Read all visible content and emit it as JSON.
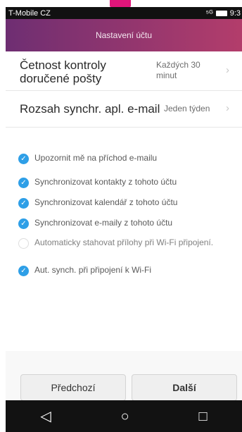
{
  "status_bar": {
    "carrier": "T-Mobile CZ",
    "signal": "⁵ᴳ",
    "time": "9:3"
  },
  "title_bar": {
    "title": "Nastavení účtu"
  },
  "settings": [
    {
      "label": "Četnost kontroly doručené pošty",
      "value": "Každých 30 minut"
    },
    {
      "label": "Rozsah synchr. apl. e-mail",
      "value": "Jeden týden"
    }
  ],
  "checkboxes": [
    {
      "label": "Upozornit mě na příchod e-mailu",
      "checked": true
    },
    {
      "label": "Synchronizovat kontakty z tohoto účtu",
      "checked": true
    },
    {
      "label": "Synchronizovat kalendář z tohoto účtu",
      "checked": true
    },
    {
      "label": "Synchronizovat e-maily z tohoto účtu",
      "checked": true
    },
    {
      "label": "Automaticky stahovat přílohy při Wi-Fi připojení.",
      "checked": false
    },
    {
      "label": "Aut. synch. při připojení k Wi-Fi",
      "checked": true
    }
  ],
  "buttons": {
    "previous": "Předchozí",
    "next": "Další"
  },
  "nav_icons": [
    "back-icon",
    "home-icon",
    "recent-apps-icon"
  ],
  "colors": {
    "accent_start": "#6e2e72",
    "accent_end": "#b33d6b",
    "checkbox": "#2e9fe7",
    "highlight": "#e0157a"
  }
}
